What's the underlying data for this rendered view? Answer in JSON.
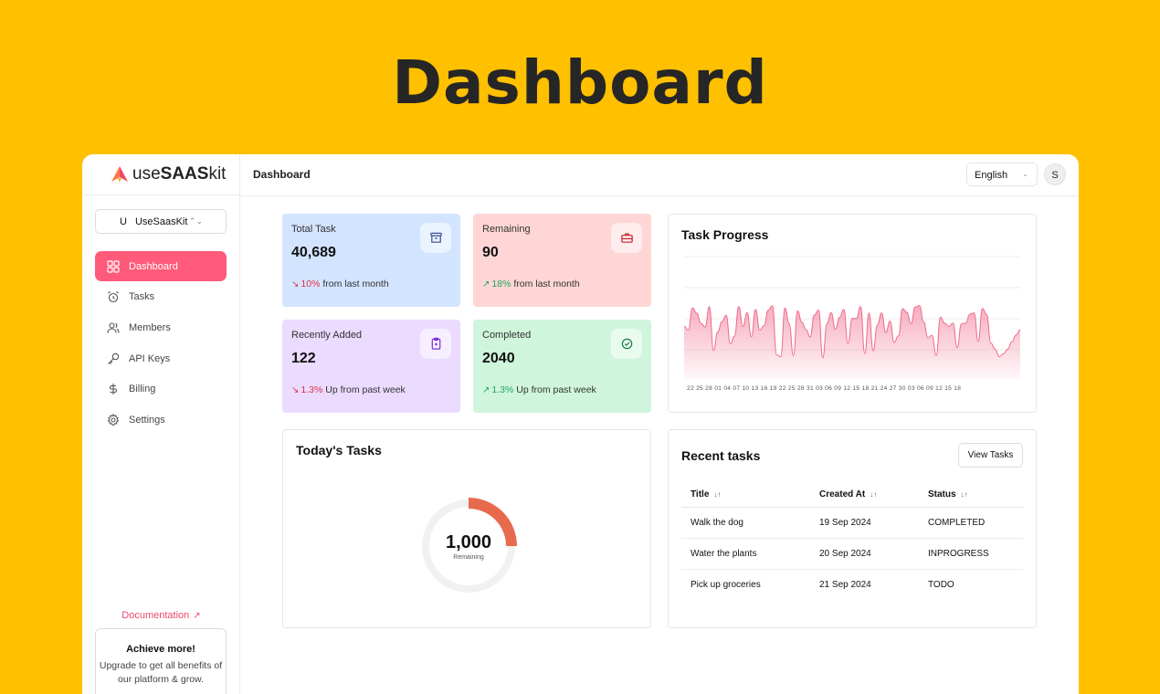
{
  "hero": {
    "title": "Dashboard"
  },
  "brand": {
    "prefix": "use",
    "bold": "SAAS",
    "suffix": "kit"
  },
  "org": {
    "initial": "U",
    "name": "UseSaasKit"
  },
  "nav": [
    {
      "label": "Dashboard",
      "icon": "grid-icon",
      "active": true
    },
    {
      "label": "Tasks",
      "icon": "alarm-clock-icon"
    },
    {
      "label": "Members",
      "icon": "users-icon"
    },
    {
      "label": "API Keys",
      "icon": "key-icon"
    },
    {
      "label": "Billing",
      "icon": "dollar-icon"
    },
    {
      "label": "Settings",
      "icon": "gear-icon"
    }
  ],
  "sidebar_footer": {
    "doc_label": "Documentation",
    "upsell_title": "Achieve more!",
    "upsell_text_1": "Upgrade to get all benefits of",
    "upsell_text_2": "our platform & grow."
  },
  "topbar": {
    "breadcrumb": "Dashboard",
    "language": "English",
    "avatar_initial": "S"
  },
  "stats": [
    {
      "label": "Total Task",
      "value": "40,689",
      "pct": "10%",
      "rest": "from last month",
      "trend": "down",
      "icon": "archive-icon",
      "bg": "#D3E4FF",
      "icon_color": "#3B4D8F"
    },
    {
      "label": "Remaining",
      "value": "90",
      "pct": "18%",
      "rest": "from last month",
      "trend": "up",
      "icon": "briefcase-icon",
      "bg": "#FFD6D6",
      "icon_color": "#C4242E"
    },
    {
      "label": "Recently Added",
      "value": "122",
      "pct": "1.3%",
      "rest": "Up from past week",
      "trend": "down",
      "icon": "clipboard-icon",
      "bg": "#EADBFF",
      "icon_color": "#7C2FD8"
    },
    {
      "label": "Completed",
      "value": "2040",
      "pct": "1.3%",
      "rest": "Up from past week",
      "trend": "up",
      "icon": "check-circle-icon",
      "bg": "#CFF5DC",
      "icon_color": "#1E7A44"
    }
  ],
  "task_progress": {
    "title": "Task Progress",
    "ticks": [
      "22",
      "25",
      "28",
      "01",
      "04",
      "07",
      "10",
      "13",
      "16",
      "19",
      "22",
      "25",
      "28",
      "31",
      "03",
      "06",
      "09",
      "12",
      "15",
      "18",
      "21",
      "24",
      "27",
      "30",
      "03",
      "06",
      "09",
      "12",
      "15",
      "18"
    ],
    "color": "#F06A8A"
  },
  "today": {
    "title": "Today's Tasks",
    "value": "1,000",
    "sub": "Remaining",
    "fraction": 0.25,
    "accent": "#E86A4E"
  },
  "recent": {
    "title": "Recent tasks",
    "button": "View Tasks",
    "columns": [
      "Title",
      "Created At",
      "Status"
    ],
    "rows": [
      [
        "Walk the dog",
        "19 Sep 2024",
        "COMPLETED"
      ],
      [
        "Water the plants",
        "20 Sep 2024",
        "INPROGRESS"
      ],
      [
        "Pick up groceries",
        "21 Sep 2024",
        "TODO"
      ]
    ]
  }
}
